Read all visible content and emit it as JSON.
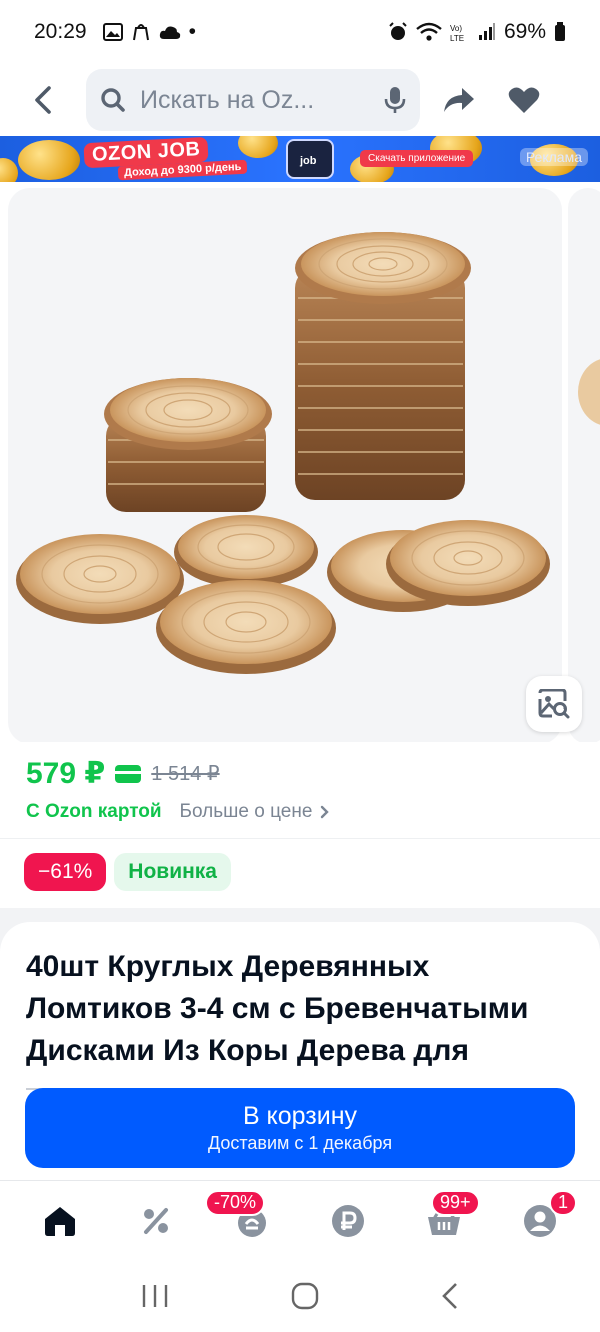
{
  "status_bar": {
    "time": "20:29",
    "battery": "69%",
    "dot": "•"
  },
  "search": {
    "placeholder": "Искать на Oz..."
  },
  "ad_banner": {
    "brand": "OZON JOB",
    "subtitle": "Доход до 9300 р/день",
    "phone_label": "job",
    "download_label": "Скачать приложение",
    "tag": "Реклама"
  },
  "price": {
    "current": "579 ₽",
    "old": "1 514 ₽",
    "card_label": "С Ozon картой",
    "more_label": "Больше о цене"
  },
  "tags": {
    "discount": "−61%",
    "new": "Новинка"
  },
  "product": {
    "title": "40шт Круглых Деревянных Ломтиков 3-4 см с Бревенчатыми Дисками Из Коры Дерева для"
  },
  "cart_button": {
    "label": "В корзину",
    "sub": "Доставим с 1 декабря"
  },
  "bottom_nav": {
    "items": [
      {
        "icon": "home-icon",
        "badge": ""
      },
      {
        "icon": "percent-icon",
        "badge": ""
      },
      {
        "icon": "fresh-icon",
        "badge": "-70%"
      },
      {
        "icon": "ruble-icon",
        "badge": ""
      },
      {
        "icon": "cart-icon",
        "badge": "99+"
      },
      {
        "icon": "profile-icon",
        "badge": "1"
      }
    ]
  },
  "colors": {
    "brand_blue": "#005bff",
    "price_green": "#10c44c",
    "discount_pink": "#f0154f"
  }
}
